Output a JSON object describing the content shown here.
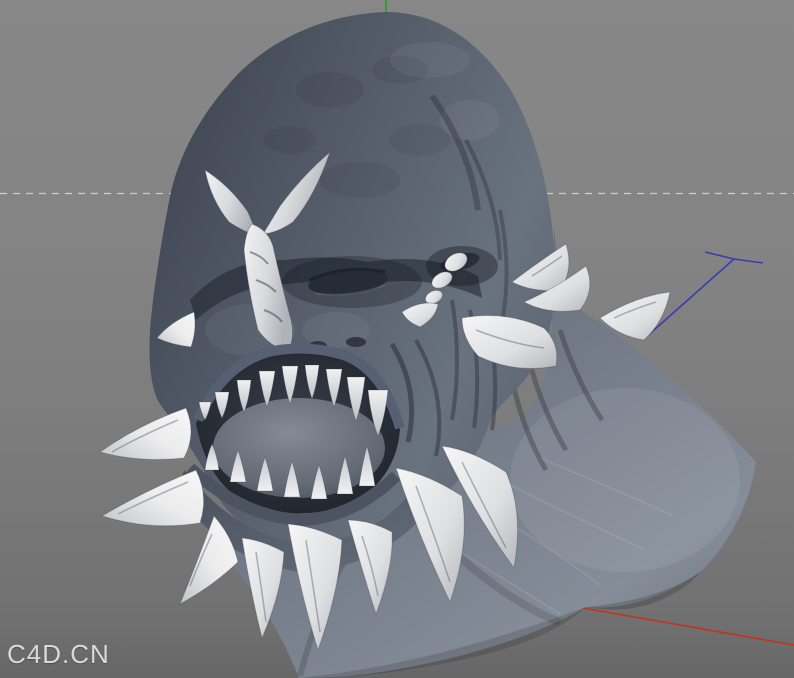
{
  "viewport": {
    "watermark": "C4D.CN",
    "background": {
      "top": "#878787",
      "bottom": "#707070"
    },
    "horizon_line": {
      "color": "#cdcdcd"
    },
    "axes": {
      "y": {
        "icon": "y-axis-line",
        "color": "#2f9e30"
      },
      "z": {
        "icon": "z-axis-line",
        "color": "#3a3db0"
      },
      "x": {
        "icon": "x-axis-line",
        "color": "#c5311f"
      }
    },
    "model": {
      "name": "creature-bust-sculpture",
      "colors": {
        "skin_dark": "#3e4451",
        "skin_mid": "#59616f",
        "skin_light": "#828a97",
        "bone_light": "#f3f3f4",
        "bone_shade": "#b7bbc1",
        "mouth_cavity": "#232831",
        "eye": "#262c36"
      }
    }
  }
}
